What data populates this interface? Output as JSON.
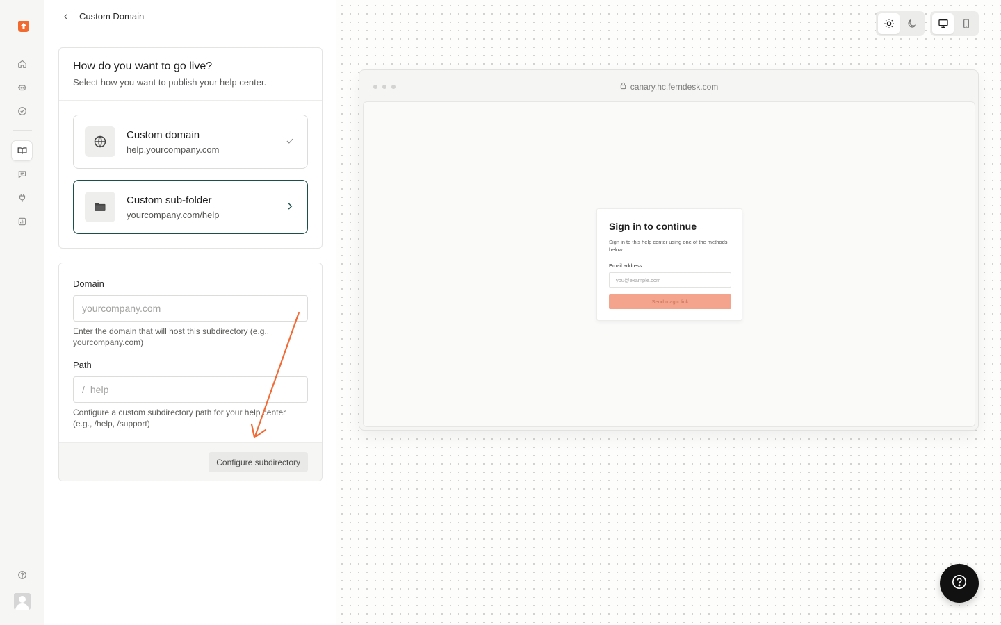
{
  "rail": {
    "items": [
      "home-icon",
      "bot-icon",
      "check-circle-icon",
      "book-open-icon",
      "chat-icon",
      "plug-icon",
      "chart-icon"
    ],
    "active": "book-open-icon",
    "bottom": [
      "help-circle-icon",
      "avatar"
    ],
    "brand_color": "#f26a2e"
  },
  "header": {
    "title": "Custom Domain"
  },
  "golive": {
    "title": "How do you want to go live?",
    "subtitle": "Select how you want to publish your help center.",
    "options": [
      {
        "title": "Custom domain",
        "subtitle": "help.yourcompany.com",
        "icon": "globe-icon",
        "status": "check-icon"
      },
      {
        "title": "Custom sub-folder",
        "subtitle": "yourcompany.com/help",
        "icon": "folder-icon",
        "status": "chevron-right-icon",
        "selected": true
      }
    ]
  },
  "form": {
    "domain_label": "Domain",
    "domain_placeholder": "yourcompany.com",
    "domain_help": "Enter the domain that will host this subdirectory (e.g., yourcompany.com)",
    "path_label": "Path",
    "path_prefix": "/",
    "path_value": "help",
    "path_help": "Configure a custom subdirectory path for your help center (e.g., /help, /support)",
    "submit_label": "Configure subdirectory"
  },
  "annotation": {
    "color": "#f26a35"
  },
  "preview": {
    "theme_options": [
      "sun-icon",
      "moon-icon"
    ],
    "device_options": [
      "monitor-icon",
      "smartphone-icon"
    ],
    "url": "canary.hc.ferndesk.com",
    "signin": {
      "title": "Sign in to continue",
      "subtitle": "Sign in to this help center using one of the methods below.",
      "email_label": "Email address",
      "email_placeholder": "you@example.com",
      "button_label": "Send magic link",
      "button_color": "#f4a48c"
    }
  },
  "help_button": {
    "icon": "question-mark-icon"
  }
}
